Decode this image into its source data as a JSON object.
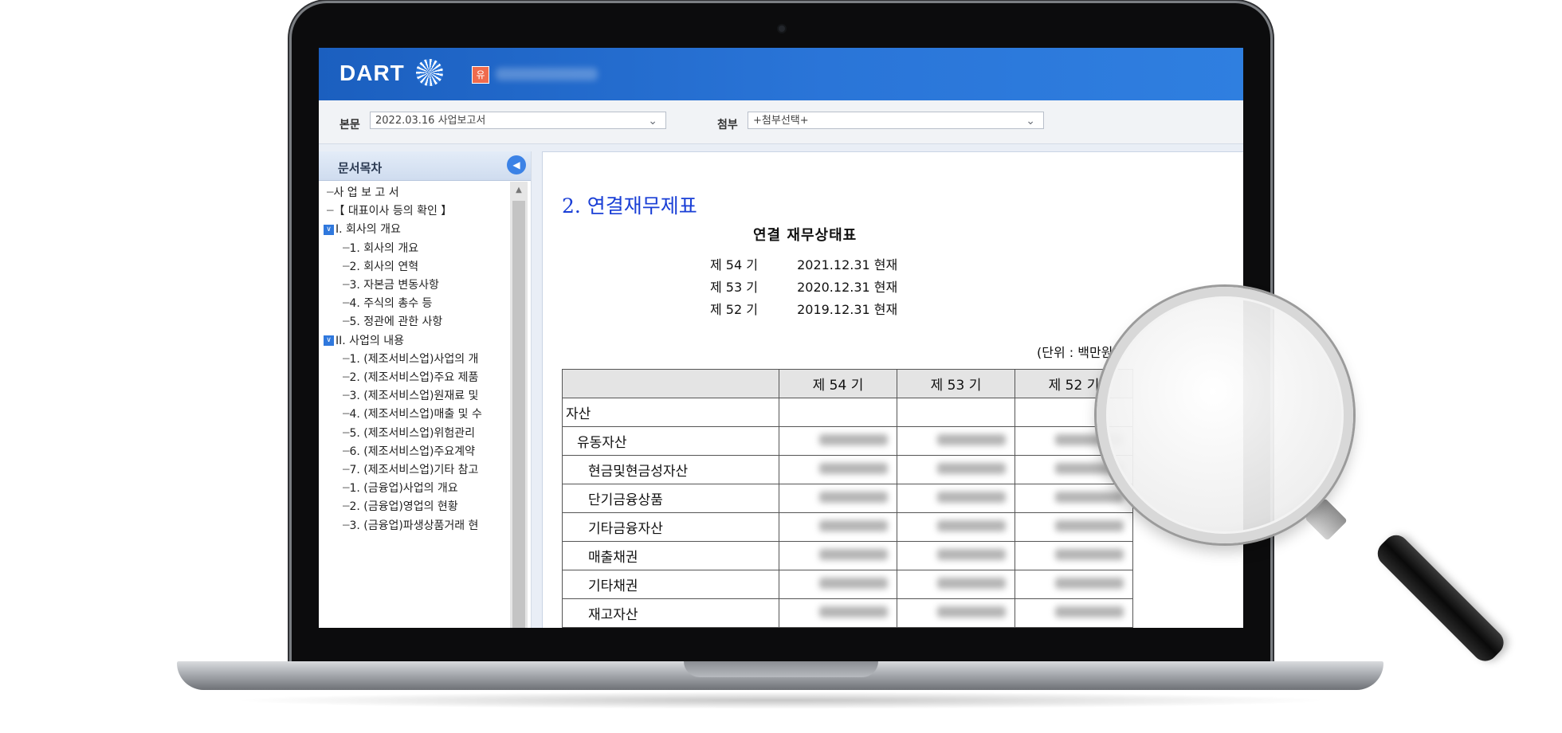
{
  "header": {
    "logo_text": "DART",
    "company_badge": "유"
  },
  "selectors": {
    "main_label": "본문",
    "main_value": "2022.03.16  사업보고서",
    "attach_label": "첨부",
    "attach_value": "+첨부선택+"
  },
  "toc": {
    "title": "문서목차",
    "items": [
      {
        "label": "사 업 보 고 서",
        "level": 0,
        "expand": false
      },
      {
        "label": "【 대표이사 등의 확인 】",
        "level": 0,
        "expand": false
      },
      {
        "label": "I. 회사의 개요",
        "level": 0,
        "expand": true
      },
      {
        "label": "1. 회사의 개요",
        "level": 1,
        "expand": false
      },
      {
        "label": "2. 회사의 연혁",
        "level": 1,
        "expand": false
      },
      {
        "label": "3. 자본금 변동사항",
        "level": 1,
        "expand": false
      },
      {
        "label": "4. 주식의 총수 등",
        "level": 1,
        "expand": false
      },
      {
        "label": "5. 정관에 관한 사항",
        "level": 1,
        "expand": false
      },
      {
        "label": "II. 사업의 내용",
        "level": 0,
        "expand": true
      },
      {
        "label": "1. (제조서비스업)사업의 개",
        "level": 1,
        "expand": false
      },
      {
        "label": "2. (제조서비스업)주요 제품",
        "level": 1,
        "expand": false
      },
      {
        "label": "3. (제조서비스업)원재료 및",
        "level": 1,
        "expand": false
      },
      {
        "label": "4. (제조서비스업)매출 및 수",
        "level": 1,
        "expand": false
      },
      {
        "label": "5. (제조서비스업)위험관리",
        "level": 1,
        "expand": false
      },
      {
        "label": "6. (제조서비스업)주요계약",
        "level": 1,
        "expand": false
      },
      {
        "label": "7. (제조서비스업)기타 참고",
        "level": 1,
        "expand": false
      },
      {
        "label": "1. (금융업)사업의 개요",
        "level": 1,
        "expand": false
      },
      {
        "label": "2. (금융업)영업의 현황",
        "level": 1,
        "expand": false
      },
      {
        "label": "3. (금융업)파생상품거래 현",
        "level": 1,
        "expand": false
      }
    ]
  },
  "document": {
    "section_title": "2. 연결재무제표",
    "statement_title": "연결 재무상태표",
    "periods": [
      {
        "term": "제 54 기",
        "date": "2021.12.31 현재"
      },
      {
        "term": "제 53 기",
        "date": "2020.12.31 현재"
      },
      {
        "term": "제 52 기",
        "date": "2019.12.31 현재"
      }
    ],
    "unit": "(단위 : 백만원)",
    "table": {
      "headers": [
        "",
        "제 54 기",
        "제 53 기",
        "제 52 기"
      ],
      "rows": [
        {
          "label": "자산",
          "indent": 0,
          "blurred": false
        },
        {
          "label": "유동자산",
          "indent": 1,
          "blurred": true
        },
        {
          "label": "현금및현금성자산",
          "indent": 2,
          "blurred": true
        },
        {
          "label": "단기금융상품",
          "indent": 2,
          "blurred": true
        },
        {
          "label": "기타금융자산",
          "indent": 2,
          "blurred": true
        },
        {
          "label": "매출채권",
          "indent": 2,
          "blurred": true
        },
        {
          "label": "기타채권",
          "indent": 2,
          "blurred": true
        },
        {
          "label": "재고자산",
          "indent": 2,
          "blurred": true
        }
      ]
    }
  },
  "icons": {
    "toggle": "chevron-left-icon",
    "dropdown": "chevron-down-icon",
    "expand": "chevron-down-icon",
    "magnifier": "magnifying-glass-icon"
  },
  "colors": {
    "header_blue": "#2a75d8",
    "section_title_blue": "#1a3fd6",
    "badge_orange": "#ef6b4d"
  }
}
